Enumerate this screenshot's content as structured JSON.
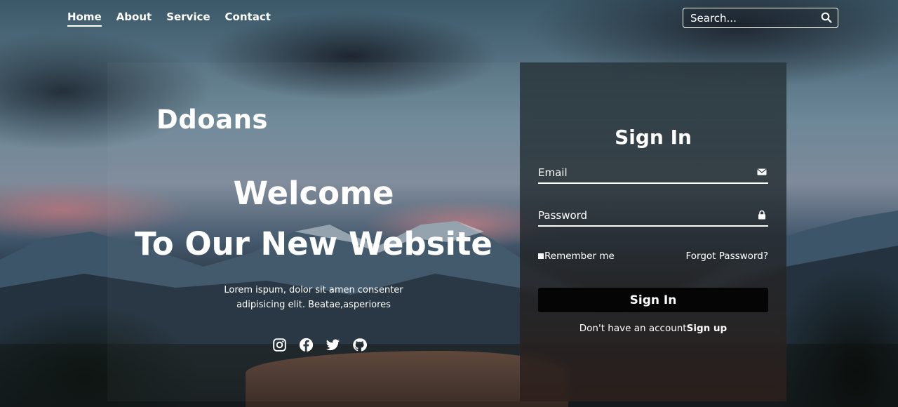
{
  "nav": {
    "items": [
      {
        "label": "Home",
        "active": true
      },
      {
        "label": "About"
      },
      {
        "label": "Service"
      },
      {
        "label": "Contact"
      }
    ]
  },
  "search": {
    "placeholder": "Search...",
    "icon": "search-icon"
  },
  "hero": {
    "brand": "Ddoans",
    "welcome_line1": "Welcome",
    "welcome_line2": "To Our New Website",
    "description": "Lorem ispum, dolor sit amen consenter adipisicing elit. Beatae,asperiores",
    "socials": [
      "instagram-icon",
      "facebook-icon",
      "twitter-icon",
      "github-icon"
    ]
  },
  "login": {
    "title": "Sign In",
    "email_placeholder": "Email",
    "password_placeholder": "Password",
    "remember_label": "Remember me",
    "forgot_label": "Forgot Password?",
    "button_label": "Sign In",
    "no_account_text": "Don't have an account",
    "signup_label": "Sign up"
  },
  "colors": {
    "text": "#ffffff",
    "button_bg": "#050505"
  }
}
